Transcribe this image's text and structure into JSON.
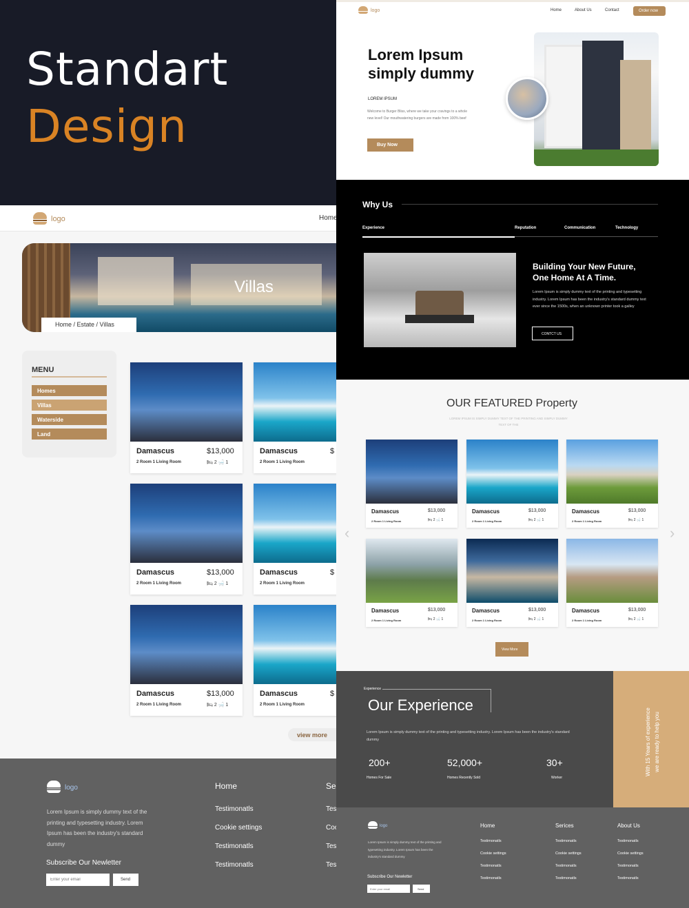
{
  "hero_left": {
    "line1": "Standart",
    "line2": "Design"
  },
  "left": {
    "logo": "logo",
    "nav_home": "Home",
    "banner_title": "Villas",
    "breadcrumb": "Home / Estate / Villas",
    "menu": {
      "title": "MENU",
      "items": [
        "Homes",
        "Villas",
        "Waterside",
        "Land"
      ]
    },
    "cards": [
      {
        "name": "Damascus",
        "price": "$13,000",
        "info": "2 Room  1 Living Room",
        "beds": "2",
        "baths": "1"
      },
      {
        "name": "Damascus",
        "price": "$",
        "info": "2 Room  1 Living Room"
      }
    ],
    "view_more": "view more",
    "footer": {
      "logo": "logo",
      "text": "Lorem Ipsum is simply dummy text of the printing and typesetting industry.  Lorem Ipsum has been the industry's standard dummy",
      "subscribe": "Subscribe Our Newletter",
      "email_placeholder": "Enter your email",
      "send": "Send",
      "col1_title": "Home",
      "col1_items": [
        "Testimonatls",
        "Cookie settings",
        "Testimonatls",
        "Testimonatls"
      ],
      "col2_title": "Se",
      "col2_items": [
        "Tes",
        "Coo",
        "Tes",
        "Tes"
      ]
    }
  },
  "right": {
    "nav": {
      "logo": "logo",
      "items": [
        "Home",
        "About Us",
        "Contact"
      ],
      "cta": "Order now"
    },
    "hero": {
      "title1": "Lorem Ipsum",
      "title2": "simply dummy",
      "label": "LOREM IPSUM",
      "text": "Welcome to Burger Bliss, where we take your cravings to a whole new level! Our mouthwatering burgers are made from 100% beef",
      "button": "Buy Now"
    },
    "why": {
      "title": "Why Us",
      "tabs": [
        "Experience",
        "Reputation",
        "Communication",
        "Technology"
      ],
      "heading1": "Building Your New Future,",
      "heading2": "One Home At A Time.",
      "text": "Lorem Ipsum is simply dummy text of the printing and typesetting industry. Lorem Ipsum has been the industry's standard dummy text ever since the 1500s, when an unknown printer took a galley",
      "button": "CONTCT US"
    },
    "featured": {
      "title": "OUR FEATURED Property",
      "subtitle": "LOREM IPSUM IS SIMPLY DUMMY TEXT OF THE PRINTING AND SIMPLY DUMMY TEXT OF THE",
      "card_name": "Damascus",
      "card_price": "$13,000",
      "card_info": "2 Room  1 Living Room",
      "beds": "2",
      "baths": "1",
      "button": "View More"
    },
    "experience": {
      "label": "Experience",
      "title": "Our Experience",
      "text": "Lorem Ipsum is simply dummy text of the printing and typesetting industry. Lorem Ipsum has been the industry's standard dummy",
      "stats": [
        {
          "value": "200+",
          "label": "Homes For Sale"
        },
        {
          "value": "52,000+",
          "label": "Homes Recently Sold"
        },
        {
          "value": "30+",
          "label": "Worker"
        }
      ],
      "side1": "With 15 Years of experience",
      "side2": "we are ready to help you"
    },
    "footer": {
      "logo": "logo",
      "text": "Lorem Ipsum is simply dummy text of the printing and typesetting industry.  Lorem Ipsum has been the industry's standard dummy",
      "subscribe": "Subscribe Our Newletter",
      "email_placeholder": "Enter your email",
      "send": "Send",
      "cols": [
        {
          "title": "Home",
          "items": [
            "Testimonatls",
            "Cookie settings",
            "Testimonatls",
            "Testimonatls"
          ]
        },
        {
          "title": "Serices",
          "items": [
            "Testimonatls",
            "Cookie settings",
            "Testimonatls",
            "Testimonatls"
          ]
        },
        {
          "title": "About Us",
          "items": [
            "Testimonatls",
            "Cookie settings",
            "Testimonatls",
            "Testimonatls"
          ]
        }
      ]
    }
  },
  "colors": {
    "accent": "#b48b5b",
    "dark": "#181b27",
    "orange": "#d98324",
    "footer": "#616161",
    "exp": "#4a4a4a",
    "tan": "#d6ad7a"
  }
}
